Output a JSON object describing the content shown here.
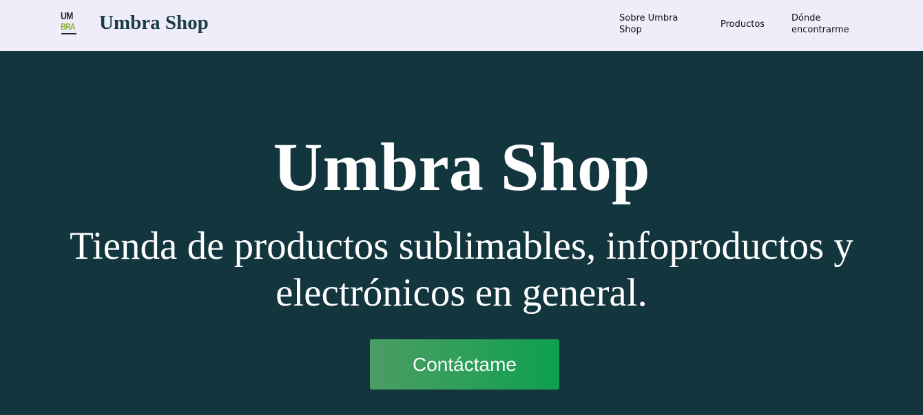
{
  "header": {
    "logo": {
      "line1": "UM",
      "line2": "BRA"
    },
    "brand": "Umbra Shop",
    "nav": [
      {
        "label": "Sobre Umbra Shop"
      },
      {
        "label": "Productos"
      },
      {
        "label": "Dónde encontrarme"
      }
    ]
  },
  "hero": {
    "title": "Umbra Shop",
    "subtitle": "Tienda de productos sublimables, infoproductos y electrónicos en general.",
    "cta_label": "Contáctame"
  },
  "colors": {
    "header_bg": "#efedfa",
    "hero_bg": "#12353e",
    "brand_text": "#1a3d46",
    "cta_start": "#4a9d65",
    "cta_end": "#0e9f4f"
  }
}
